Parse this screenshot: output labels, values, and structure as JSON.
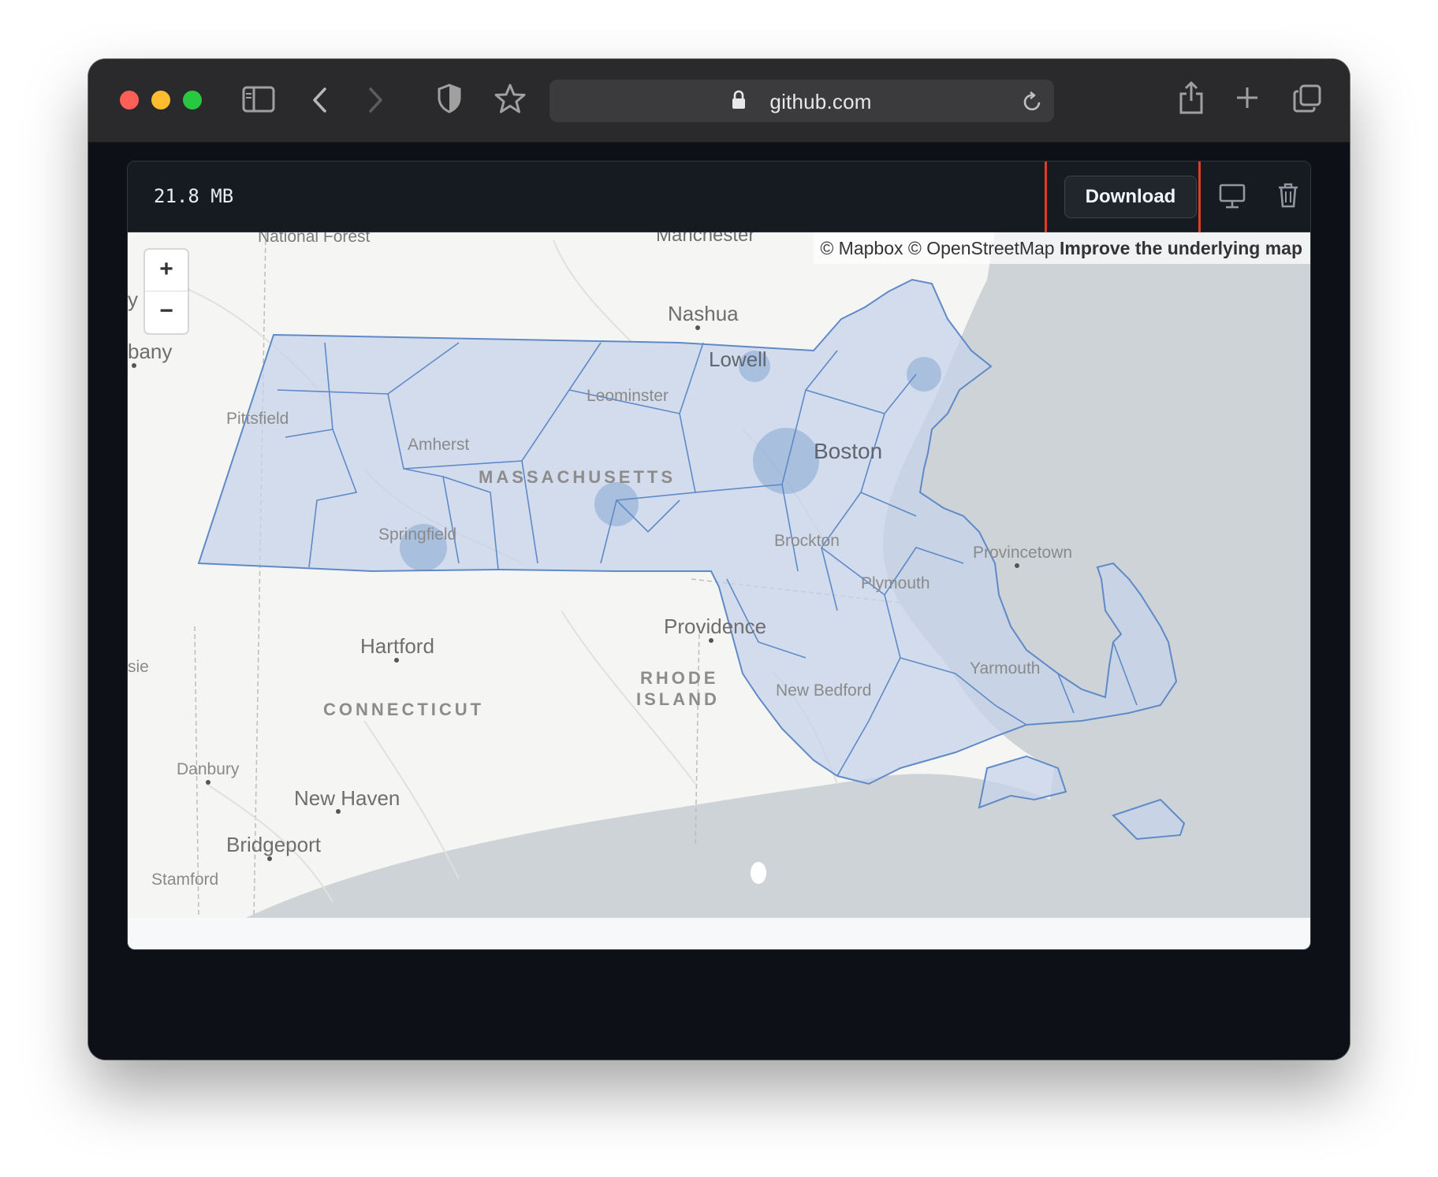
{
  "browser": {
    "url": "github.com",
    "traffic_lights": {
      "close": "#fe5f57",
      "minimize": "#febc2e",
      "maximize": "#28c840"
    },
    "icons": [
      "sidebar-icon",
      "back-icon",
      "forward-icon",
      "shield-icon",
      "star-icon",
      "lock-icon",
      "reload-icon",
      "share-icon",
      "new-tab-icon",
      "tabs-overview-icon"
    ]
  },
  "file_header": {
    "size": "21.8 MB",
    "download_label": "Download",
    "icons": [
      "display-icon",
      "trash-icon"
    ]
  },
  "map": {
    "attribution": {
      "mapbox": "© Mapbox",
      "osm": "© OpenStreetMap",
      "improve": "Improve the underlying map"
    },
    "zoom_in": "+",
    "zoom_out": "−",
    "logo": "mapbox",
    "places": {
      "national_forest": "National Forest",
      "manchester": "Manchester",
      "nashua": "Nashua",
      "albany": "bany",
      "y_edge": "y",
      "lowell": "Lowell",
      "leominster": "Leominster",
      "pittsfield": "Pittsfield",
      "amherst": "Amherst",
      "boston": "Boston",
      "massachusetts": "MASSACHUSETTS",
      "springfield": "Springfield",
      "brockton": "Brockton",
      "provincetown": "Provincetown",
      "plymouth": "Plymouth",
      "providence": "Providence",
      "hartford": "Hartford",
      "sie": "sie",
      "rhode": "RHODE",
      "island": "ISLAND",
      "yarmouth": "Yarmouth",
      "new_bedford": "New Bedford",
      "connecticut": "CONNECTICUT",
      "danbury": "Danbury",
      "new_haven": "New Haven",
      "bridgeport": "Bridgeport",
      "stamford": "Stamford"
    },
    "colors": {
      "land": "#f5f5f3",
      "water": "#cdd3d6",
      "boundary_fill": "#c5d3ea",
      "boundary_stroke": "#5f8ac7"
    }
  }
}
